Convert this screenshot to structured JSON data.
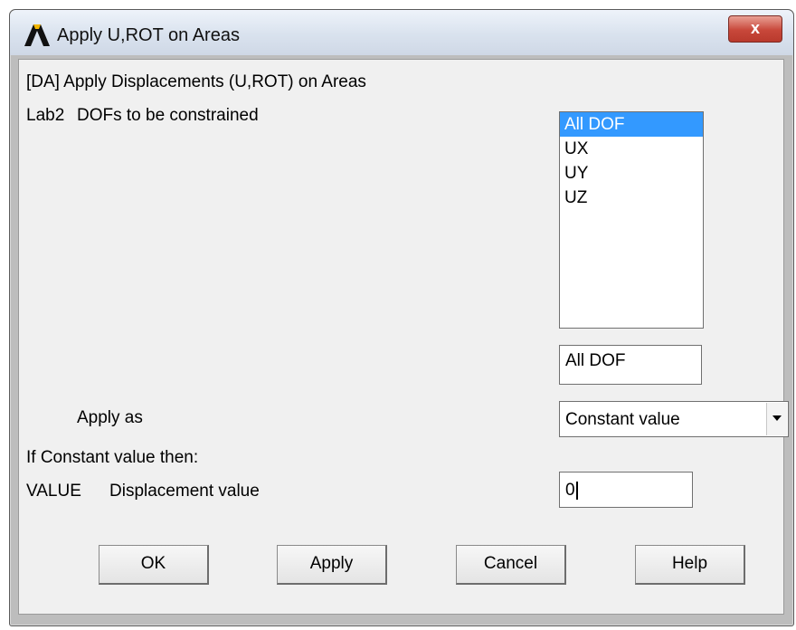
{
  "window": {
    "title": "Apply U,ROT on Areas",
    "close_label": "x"
  },
  "form": {
    "header": "[DA]  Apply Displacements (U,ROT) on Areas",
    "lab2_key": "Lab2",
    "lab2_desc": "DOFs to be constrained",
    "dof_list": [
      "All DOF",
      "UX",
      "UY",
      "UZ"
    ],
    "dof_selected_index": 0,
    "dof_field_value": "All DOF",
    "apply_as_label": "Apply as",
    "apply_as_value": "Constant value",
    "if_constant_label": "If Constant value then:",
    "value_key": "VALUE",
    "value_desc": "Displacement value",
    "value_input": "0"
  },
  "buttons": {
    "ok": "OK",
    "apply": "Apply",
    "cancel": "Cancel",
    "help": "Help"
  },
  "icons": {
    "app_logo": "ansys-logo-icon",
    "dropdown_arrow": "chevron-down-icon",
    "close": "close-icon"
  },
  "colors": {
    "selection": "#3399ff",
    "dialog_bg": "#f0f0f0",
    "close_button": "#c8473a"
  }
}
